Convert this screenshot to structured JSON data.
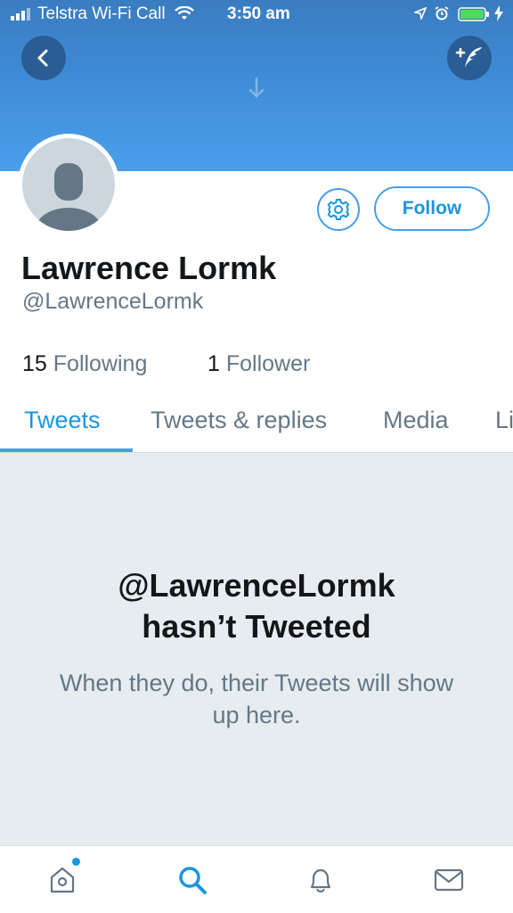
{
  "status_bar": {
    "carrier": "Telstra Wi-Fi Call",
    "time": "3:50 am"
  },
  "header": {
    "back_icon": "chevron-left-icon",
    "compose_icon": "compose-tweet-icon"
  },
  "profile": {
    "display_name": "Lawrence Lormk",
    "handle": "@LawrenceLormk",
    "follow_label": "Follow",
    "following_count": "15",
    "following_label": "Following",
    "followers_count": "1",
    "followers_label": "Follower"
  },
  "tabs": [
    {
      "label": "Tweets",
      "active": true
    },
    {
      "label": "Tweets & replies",
      "active": false
    },
    {
      "label": "Media",
      "active": false
    },
    {
      "label": "Likes",
      "active": false
    }
  ],
  "empty_state": {
    "title_line1": "@LawrenceLormk",
    "title_line2": "hasn’t Tweeted",
    "subtitle": "When they do, their Tweets will show up here."
  },
  "bottom_nav": [
    {
      "name": "home",
      "icon": "home-icon"
    },
    {
      "name": "search",
      "icon": "search-icon",
      "active": true
    },
    {
      "name": "notifications",
      "icon": "bell-icon"
    },
    {
      "name": "messages",
      "icon": "mail-icon"
    }
  ],
  "colors": {
    "accent": "#1b95e0",
    "banner": "#4a9fea",
    "muted_text": "#657786",
    "background": "#e6ecf0"
  }
}
